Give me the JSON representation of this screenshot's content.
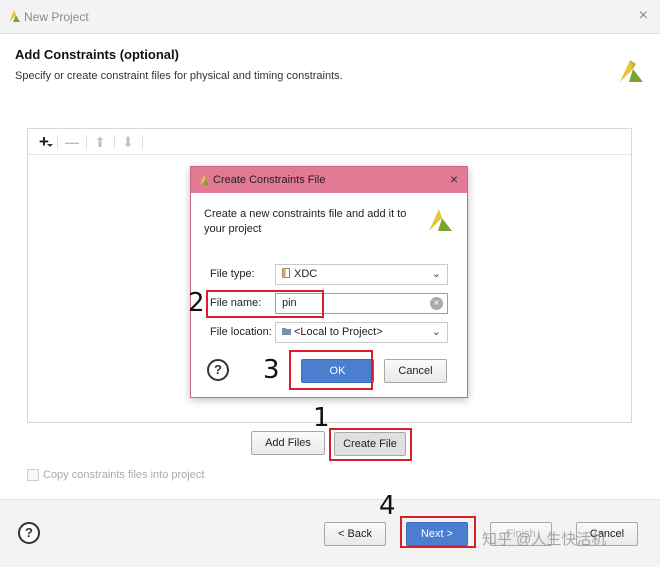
{
  "window": {
    "title": "New Project",
    "close_glyph": "×"
  },
  "header": {
    "title": "Add Constraints (optional)",
    "subtitle": "Specify or create constraint files for physical and timing constraints."
  },
  "toolbar": {
    "add_glyph": "+",
    "remove_glyph": "—",
    "up_glyph": "⬆",
    "down_glyph": "⬇"
  },
  "actions": {
    "add_files": "Add Files",
    "create_file": "Create File"
  },
  "copy_checkbox": {
    "label": "Copy constraints files into project",
    "checked": false,
    "enabled": false
  },
  "footer": {
    "help": "?",
    "back": "< Back",
    "next": "Next >",
    "finish": "Finish",
    "cancel": "Cancel",
    "watermark": "知乎 @人生快活机"
  },
  "dialog": {
    "title": "Create Constraints File",
    "close_glyph": "×",
    "description": "Create a new constraints file and add it to your project",
    "file_type_label": "File type:",
    "file_type_value": "XDC",
    "file_name_label": "File name:",
    "file_name_value": "pin",
    "file_location_label": "File location:",
    "file_location_value": "<Local to Project>",
    "help": "?",
    "ok": "OK",
    "cancel": "Cancel"
  },
  "annotations": {
    "step_1": "1",
    "step_2": "2",
    "step_3": "3",
    "step_4": "4"
  },
  "colors": {
    "dialog_titlebar": "#e37a95",
    "primary_button": "#4a7fd0",
    "highlight": "#d9202a",
    "logo_yellow": "#e8c43a",
    "logo_green": "#7aa52f"
  },
  "icons": {
    "app_logo": "vivado-logo-icon",
    "file_type": "xdc-file-icon",
    "location": "folder-icon",
    "clear": "clear-icon",
    "dropdown": "chevron-down-icon"
  }
}
